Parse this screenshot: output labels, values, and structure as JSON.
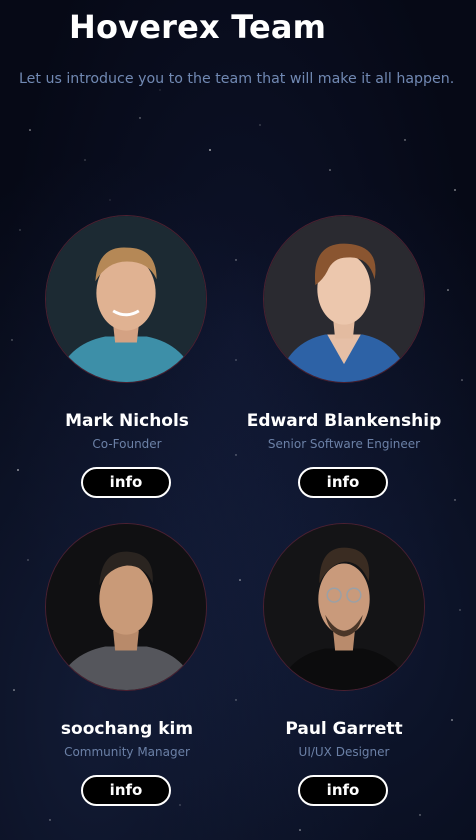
{
  "header": {
    "title": "Hoverex Team",
    "subtitle": "Let us introduce you to the team that will make it all happen.",
    "accent_color": "#1a8fe3"
  },
  "members": [
    {
      "name": "Mark Nichols",
      "role": "Co-Founder",
      "button_label": "info"
    },
    {
      "name": "Edward Blankenship",
      "role": "Senior Software Engineer",
      "button_label": "info"
    },
    {
      "name": "soochang kim",
      "role": "Community Manager",
      "button_label": "info"
    },
    {
      "name": "Paul Garrett",
      "role": "UI/UX Designer",
      "button_label": "info"
    }
  ],
  "colors": {
    "background": "#060916",
    "title": "#ffffff",
    "subtitle": "#7189b3",
    "role": "#6b80a6",
    "button_border": "#ffffff",
    "button_fill": "#000000"
  }
}
